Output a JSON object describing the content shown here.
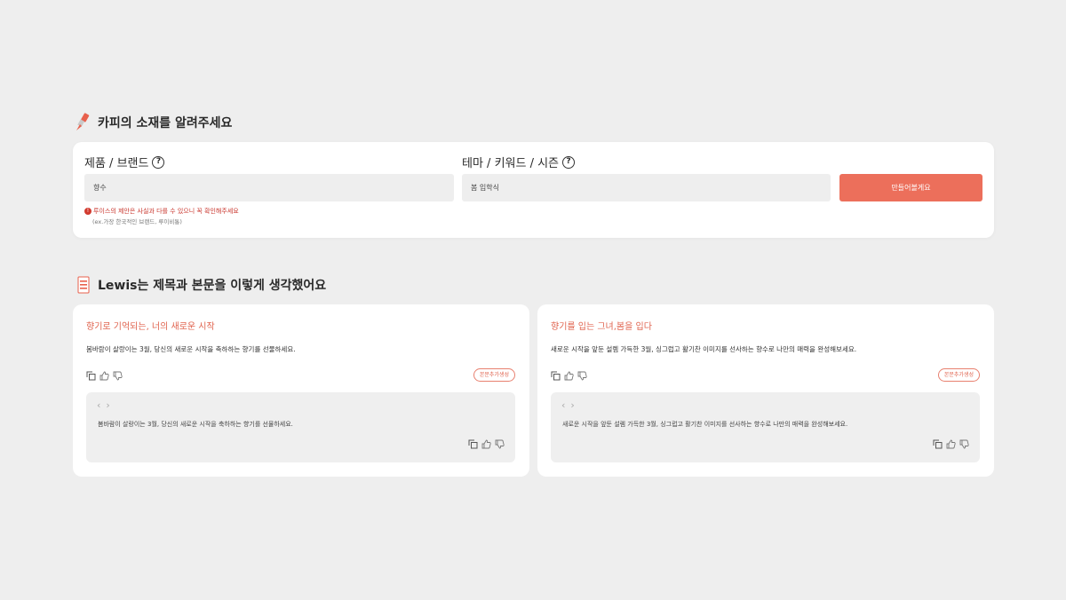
{
  "section1": {
    "title": "카피의 소재를 알려주세요"
  },
  "product": {
    "label": "제품 / 브랜드",
    "value": "향수",
    "warning": "루이스의 제안은 사실과 다를 수 있으니 꼭 확인해주세요",
    "example": "(ex.가장 한국적인 브랜드, 루이비통)"
  },
  "theme": {
    "label": "테마 / 키워드 / 시즌",
    "value": "봄 입학식"
  },
  "make_button": {
    "label": "만들어볼게요"
  },
  "section2": {
    "title": "Lewis는 제목과 본문을 이렇게 생각했어요"
  },
  "results": [
    {
      "title": "향기로 기억되는, 너의 새로운 시작",
      "body": "봄바람이 살랑이는 3월, 당신의 새로운 시작을 축하하는 향기를 선물하세요.",
      "more_label": "본문추가생성",
      "inner_body": "봄바람이 살랑이는 3월, 당신의 새로운 시작을 축하하는 향기를 선물하세요."
    },
    {
      "title": "향기를 입는 그녀,봄을 입다",
      "body": "새로운 시작을 앞둔 설렘 가득한 3월, 싱그럽고 활기찬 이미지를 선사하는 향수로 나만의 매력을 완성해보세요.",
      "more_label": "본문추가생성",
      "inner_body": "새로운 시작을 앞둔 설렘 가득한 3월, 싱그럽고 활기찬 이미지를 선사하는 향수로 나만의 매력을 완성해보세요."
    }
  ],
  "nav": {
    "prev": "‹",
    "next": "›"
  },
  "colors": {
    "accent": "#ec6f5b",
    "title_accent": "#e0644f",
    "background": "#eeeeee",
    "warning": "#c9352c"
  },
  "icons": [
    "brush-icon",
    "list-icon",
    "help-icon",
    "warning-icon",
    "copy-icon",
    "thumbs-up-icon",
    "thumbs-down-icon",
    "chevron-left-icon",
    "chevron-right-icon"
  ]
}
